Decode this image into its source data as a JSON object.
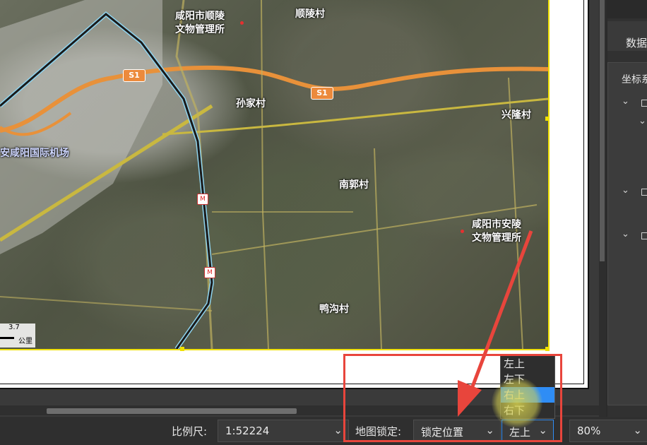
{
  "map": {
    "places": [
      {
        "id": "shunling-museum",
        "text": "咸阳市顺陵\n文物管理所"
      },
      {
        "id": "shunling-village",
        "text": "顺陵村"
      },
      {
        "id": "sunjia-village",
        "text": "孙家村"
      },
      {
        "id": "xinglong-village",
        "text": "兴隆村"
      },
      {
        "id": "airport",
        "text": "安咸阳国际机场"
      },
      {
        "id": "nanguo-village",
        "text": "南郭村"
      },
      {
        "id": "anling-museum",
        "text": "咸阳市安陵\n文物管理所"
      },
      {
        "id": "yagou-village",
        "text": "鸭沟村"
      }
    ],
    "road_shield_1": "S1",
    "road_shield_2": "S1",
    "metro_glyph": "M",
    "scale_value": "3.7",
    "scale_unit": "公里"
  },
  "side_panel": {
    "tab_label": "数据",
    "section_label": "坐标系"
  },
  "status": {
    "scale_label": "比例尺:",
    "scale_value": "1:52224",
    "lock_label": "地图锁定:",
    "lock_value": "锁定位置",
    "anchor_value": "左上",
    "zoom_value": "80%"
  },
  "anchor_dropdown": {
    "options": [
      "左上",
      "左下",
      "右上",
      "右下"
    ],
    "highlighted": "右上"
  },
  "colors": {
    "highlight": "#2f8df5",
    "annotation_red": "#e8453c",
    "map_frame_yellow": "#f0e000",
    "road_orange": "#e8913a",
    "metro_line": "#1a1a1a"
  },
  "icons": {
    "dropdown_arrow": "chevron-down-icon",
    "tree_expand": "chevron-down-icon"
  }
}
